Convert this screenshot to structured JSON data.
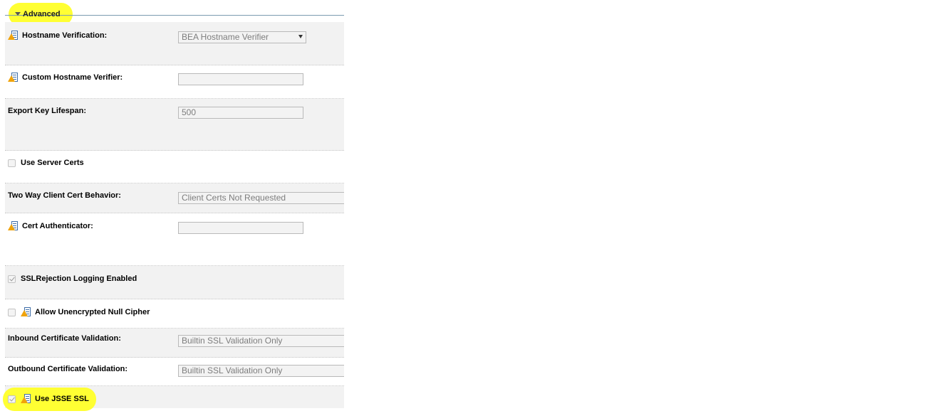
{
  "section": {
    "title": "Advanced"
  },
  "fields": {
    "hostname_verification": {
      "label": "Hostname Verification:",
      "value": "BEA Hostname Verifier"
    },
    "custom_hostname_verifier": {
      "label": "Custom Hostname Verifier:",
      "value": ""
    },
    "export_key_lifespan": {
      "label": "Export Key Lifespan:",
      "value": "500"
    },
    "use_server_certs": {
      "label": "Use Server Certs",
      "checked": false
    },
    "two_way_client_cert": {
      "label": "Two Way Client Cert Behavior:",
      "value": "Client Certs Not Requested"
    },
    "cert_authenticator": {
      "label": "Cert Authenticator:",
      "value": ""
    },
    "ssl_rejection_logging": {
      "label": "SSLRejection Logging Enabled",
      "checked": true
    },
    "allow_null_cipher": {
      "label": "Allow Unencrypted Null Cipher",
      "checked": false
    },
    "inbound_cert_validation": {
      "label": "Inbound Certificate Validation:",
      "value": "Builtin SSL Validation Only"
    },
    "outbound_cert_validation": {
      "label": "Outbound Certificate Validation:",
      "value": "Builtin SSL Validation Only"
    },
    "use_jsse_ssl": {
      "label": "Use JSSE SSL",
      "checked": true
    }
  },
  "icons": {
    "restart_required": "restart-required-icon",
    "expand": "triangle-down-icon"
  },
  "colors": {
    "highlight": "#ffff33",
    "row_shade": "#f2f2f2",
    "legend_rule": "#7a9bb0"
  }
}
